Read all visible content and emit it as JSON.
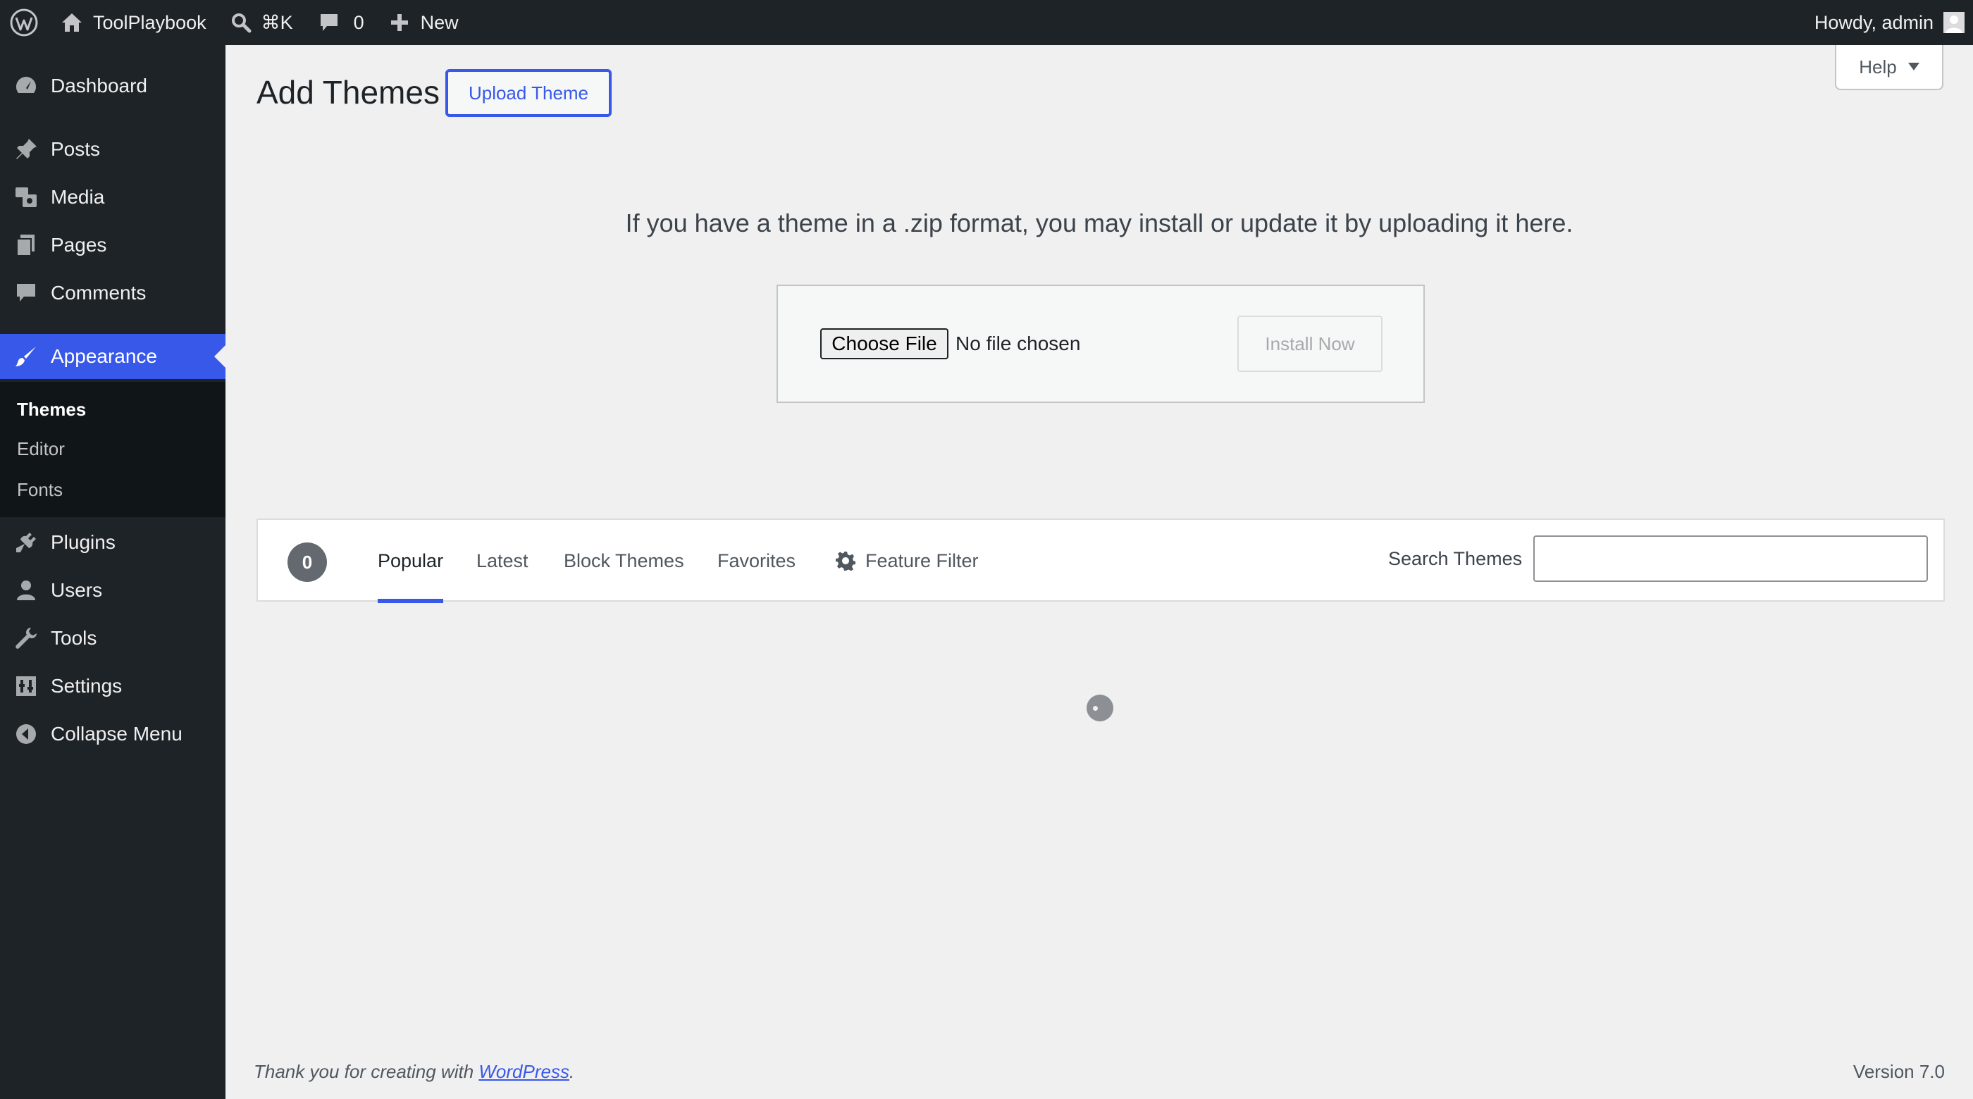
{
  "adminbar": {
    "site_name": "ToolPlaybook",
    "search_shortcut": "⌘K",
    "comments_count": "0",
    "new_label": "New",
    "greeting": "Howdy, admin"
  },
  "sidebar": {
    "items": [
      {
        "label": "Dashboard",
        "icon": "dashboard-icon"
      },
      {
        "label": "Posts",
        "icon": "pin-icon"
      },
      {
        "label": "Media",
        "icon": "media-icon"
      },
      {
        "label": "Pages",
        "icon": "pages-icon"
      },
      {
        "label": "Comments",
        "icon": "comment-icon"
      },
      {
        "label": "Appearance",
        "icon": "brush-icon"
      },
      {
        "label": "Plugins",
        "icon": "plugin-icon"
      },
      {
        "label": "Users",
        "icon": "user-icon"
      },
      {
        "label": "Tools",
        "icon": "wrench-icon"
      },
      {
        "label": "Settings",
        "icon": "settings-icon"
      },
      {
        "label": "Collapse Menu",
        "icon": "collapse-icon"
      }
    ],
    "submenu": [
      "Themes",
      "Editor",
      "Fonts"
    ]
  },
  "main": {
    "title": "Add Themes",
    "upload_button": "Upload Theme",
    "help_button": "Help",
    "upload_text": "If you have a theme in a .zip format, you may install or update it by uploading it here.",
    "choose_file": "Choose File",
    "no_file": "No file chosen",
    "install_now": "Install Now"
  },
  "filter": {
    "count": "0",
    "tabs": [
      "Popular",
      "Latest",
      "Block Themes",
      "Favorites"
    ],
    "feature_filter": "Feature Filter",
    "search_label": "Search Themes",
    "search_value": ""
  },
  "footer": {
    "thanks_prefix": "Thank you for creating with ",
    "thanks_link": "WordPress",
    "thanks_suffix": ".",
    "version": "Version 7.0"
  },
  "colors": {
    "accent": "#3858e9",
    "sidebar_bg": "#1d2327",
    "content_bg": "#f0f0f1"
  }
}
